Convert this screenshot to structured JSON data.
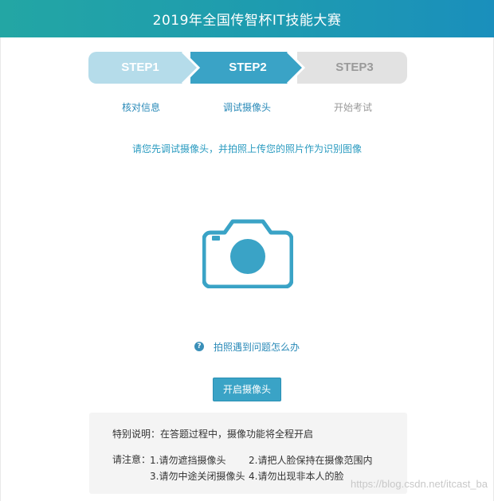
{
  "header": {
    "title": "2019年全国传智杯IT技能大赛"
  },
  "steps": [
    {
      "label": "STEP1",
      "sub": "核对信息",
      "state": "done"
    },
    {
      "label": "STEP2",
      "sub": "调试摄像头",
      "state": "active"
    },
    {
      "label": "STEP3",
      "sub": "开始考试",
      "state": "pending"
    }
  ],
  "instruction": "请您先调试摄像头，并拍照上传您的照片作为识别图像",
  "camera": {
    "icon": "camera-icon"
  },
  "help": {
    "icon": "question-icon",
    "icon_glyph": "?",
    "text": "拍照遇到问题怎么办"
  },
  "open_camera_button": "开启摄像头",
  "notes": {
    "special": "特别说明：在答题过程中，摄像功能将全程开启",
    "attention_label": "请注意：",
    "items": [
      "1.请勿遮挡摄像头",
      "2.请把人脸保持在摄像范围内",
      "3.请勿中途关闭摄像头",
      "4.请勿出现非本人的脸"
    ]
  },
  "watermark": "https://blog.csdn.net/itcast_ba",
  "colors": {
    "header_start": "#23a6a4",
    "header_end": "#1a8fbc",
    "step_done": "#b5dcea",
    "step_active": "#3aa3c6",
    "step_pending": "#e2e2e2",
    "accent": "#2a9bc0"
  }
}
